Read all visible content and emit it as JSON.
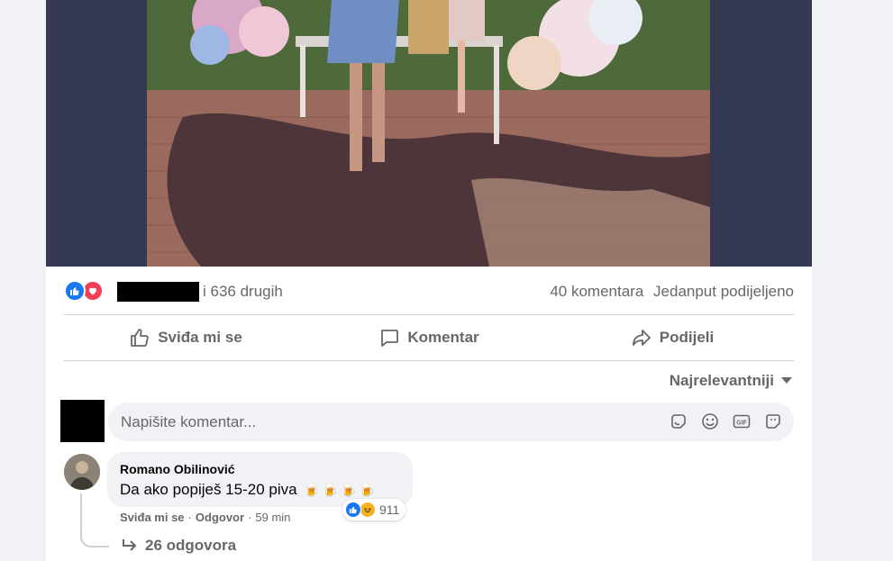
{
  "post": {
    "reactions": {
      "icons": [
        "like-icon",
        "love-icon"
      ],
      "others_text": "i 636 drugih",
      "comments_count": "40 komentara",
      "shares_text": "Jedanput podijeljeno"
    },
    "actions": [
      {
        "label": "Sviđa mi se",
        "icon": "thumbs-up-icon"
      },
      {
        "label": "Komentar",
        "icon": "comment-icon"
      },
      {
        "label": "Podijeli",
        "icon": "share-icon"
      }
    ]
  },
  "comments": {
    "sort_label": "Najrelevantniji",
    "input_placeholder": "Napišite komentar...",
    "input_icons": [
      "sticker-icon",
      "emoji-icon",
      "gif-icon",
      "sticker-face-icon"
    ],
    "items": [
      {
        "author": "Romano Obilinović",
        "text": "Da ako popiješ 15-20 piva",
        "emojis": [
          "🍺",
          "🍺",
          "🍺",
          "🍺"
        ],
        "reaction_count": "911",
        "like_label": "Sviđa mi se",
        "reply_label": "Odgovor",
        "time": "59 min",
        "replies_label": "26 odgovora"
      }
    ]
  },
  "colors": {
    "like_blue": "#1877f2",
    "love_red": "#f33e58",
    "secondary_text": "#65676b",
    "photo_frame": "#343852"
  }
}
